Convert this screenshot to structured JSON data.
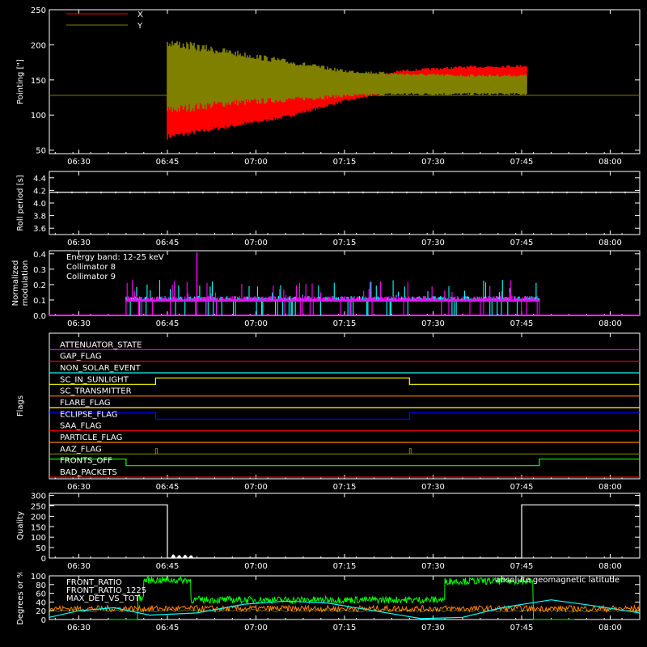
{
  "chart_data": [
    {
      "type": "line",
      "ylabel": "Pointing [\"]",
      "yticks": [
        50,
        100,
        150,
        200,
        250
      ],
      "ylim": [
        45,
        250
      ],
      "xticks": [
        "06:30",
        "06:45",
        "07:00",
        "07:15",
        "07:30",
        "07:45",
        "08:00"
      ],
      "xlim_min": [
        385,
        485
      ],
      "legend": [
        {
          "name": "X",
          "color": "#ff0000"
        },
        {
          "name": "Y",
          "color": "#808000"
        }
      ],
      "baseline": 128,
      "series": [
        {
          "name": "X",
          "color": "#ff0000",
          "x_min": [
            405,
            415,
            425,
            435,
            445,
            455,
            466
          ],
          "lo": [
            65,
            80,
            95,
            118,
            135,
            140,
            140
          ],
          "hi": [
            128,
            128,
            132,
            150,
            165,
            170,
            172
          ]
        },
        {
          "name": "Y",
          "color": "#808000",
          "x_min": [
            405,
            415,
            425,
            435,
            445,
            455,
            466
          ],
          "lo": [
            100,
            112,
            118,
            125,
            128,
            128,
            128
          ],
          "hi": [
            210,
            195,
            180,
            165,
            160,
            158,
            158
          ]
        }
      ]
    },
    {
      "type": "line",
      "ylabel": "Roll period [s]",
      "yticks": [
        "3.6",
        "3.8",
        "4.0",
        "4.2",
        "4.4"
      ],
      "ylim": [
        3.5,
        4.5
      ],
      "xticks": [
        "06:30",
        "06:45",
        "07:00",
        "07:15",
        "07:30",
        "07:45",
        "08:00"
      ],
      "xlim_min": [
        385,
        485
      ],
      "series": [
        {
          "name": "Roll period",
          "color": "#ffffff",
          "value": 4.17
        }
      ]
    },
    {
      "type": "line",
      "ylabel_lines": [
        "Normalized",
        "modulation"
      ],
      "yticks": [
        "0.0",
        "0.1",
        "0.2",
        "0.3",
        "0.4"
      ],
      "ylim": [
        0,
        0.42
      ],
      "xticks": [
        "06:30",
        "06:45",
        "07:00",
        "07:15",
        "07:30",
        "07:45",
        "08:00"
      ],
      "xlim_min": [
        385,
        485
      ],
      "annotation": "Energy band: 12-25 keV",
      "legend": [
        {
          "name": "Collimator 8",
          "color": "#00ffff"
        },
        {
          "name": "Collimator 9",
          "color": "#ff00ff"
        }
      ],
      "active_range_min": [
        398,
        468
      ],
      "typical_value": 0.1
    },
    {
      "type": "line",
      "ylabel": "Flags",
      "xticks": [
        "06:30",
        "06:45",
        "07:00",
        "07:15",
        "07:30",
        "07:45",
        "08:00"
      ],
      "xlim_min": [
        385,
        485
      ],
      "flags": [
        {
          "name": "ATTENUATOR_STATE",
          "color": "#ff00ff",
          "segments": [
            [
              385,
              485,
              0
            ]
          ]
        },
        {
          "name": "GAP_FLAG",
          "color": "#ff0000",
          "segments": [
            [
              385,
              485,
              0
            ]
          ]
        },
        {
          "name": "NON_SOLAR_EVENT",
          "color": "#00ffff",
          "segments": [
            [
              385,
              485,
              0
            ]
          ]
        },
        {
          "name": "SC_IN_SUNLIGHT",
          "color": "#ffff00",
          "segments": [
            [
              385,
              403,
              0
            ],
            [
              403,
              446,
              1
            ],
            [
              446,
              485,
              0
            ]
          ]
        },
        {
          "name": "SC_TRANSMITTER",
          "color": "#ff8000",
          "segments": [
            [
              385,
              485,
              0
            ]
          ]
        },
        {
          "name": "FLARE_FLAG",
          "color": "#ffff00",
          "segments": [
            [
              385,
              485,
              0
            ]
          ]
        },
        {
          "name": "ECLIPSE_FLAG",
          "color": "#0000ff",
          "segments": [
            [
              385,
              403,
              1
            ],
            [
              403,
              446,
              0
            ],
            [
              446,
              485,
              1
            ]
          ]
        },
        {
          "name": "SAA_FLAG",
          "color": "#ff0000",
          "segments": [
            [
              385,
              485,
              0
            ]
          ]
        },
        {
          "name": "PARTICLE_FLAG",
          "color": "#ff8000",
          "segments": [
            [
              385,
              485,
              0
            ]
          ]
        },
        {
          "name": "AAZ_FLAG",
          "color": "#808000",
          "segments": [
            [
              385,
              485,
              0
            ]
          ],
          "spikes": [
            403,
            446
          ]
        },
        {
          "name": "FRONTS_OFF",
          "color": "#00ff00",
          "segments": [
            [
              385,
              398,
              1
            ],
            [
              398,
              468,
              0
            ],
            [
              468,
              485,
              1
            ]
          ]
        },
        {
          "name": "BAD_PACKETS",
          "color": "#ff0000",
          "segments": [
            [
              385,
              485,
              0
            ]
          ]
        }
      ]
    },
    {
      "type": "line",
      "ylabel": "Quality",
      "yticks": [
        0,
        50,
        100,
        150,
        200,
        250,
        300
      ],
      "ylim": [
        0,
        310
      ],
      "xticks": [
        "06:30",
        "06:45",
        "07:00",
        "07:15",
        "07:30",
        "07:45",
        "08:00"
      ],
      "xlim_min": [
        385,
        485
      ],
      "segments": [
        [
          385,
          405,
          255
        ],
        [
          405,
          465,
          0
        ],
        [
          465,
          485,
          255
        ]
      ],
      "bumps": [
        [
          406.0,
          12
        ],
        [
          407.0,
          5
        ],
        [
          408.0,
          8
        ],
        [
          409.0,
          4
        ]
      ]
    },
    {
      "type": "line",
      "ylabel": "Degrees or %",
      "yticks": [
        0,
        20,
        40,
        60,
        80,
        100
      ],
      "ylim": [
        0,
        100
      ],
      "xticks": [
        "06:30",
        "06:45",
        "07:00",
        "07:15",
        "07:30",
        "07:45",
        "08:00"
      ],
      "xlim_min": [
        385,
        485
      ],
      "legend": [
        {
          "name": "FRONT_RATIO",
          "color": "#ffff00"
        },
        {
          "name": "FRONT_RATIO_1225",
          "color": "#00ff00"
        },
        {
          "name": "MAX_DET_VS_TOT",
          "color": "#ff8000"
        }
      ],
      "legend_right": {
        "name": "absolute geomagnetic latitude",
        "color": "#00ffff"
      },
      "series": [
        {
          "name": "FRONT_RATIO_1225",
          "color": "#00ff00",
          "segments": [
            [
              395,
              400,
              0
            ],
            [
              400,
              401,
              50
            ],
            [
              401,
              409,
              90
            ],
            [
              409,
              452,
              45
            ],
            [
              452,
              467,
              88
            ],
            [
              467,
              474,
              0
            ]
          ]
        },
        {
          "name": "MAX_DET_VS_TOT",
          "color": "#ff8000",
          "level": 25
        },
        {
          "name": "FRONT_RATIO",
          "color": "#ffff00",
          "level": 20
        },
        {
          "name": "absolute geomagnetic latitude",
          "color": "#00ffff",
          "x_min": [
            385,
            390,
            396,
            402,
            410,
            418,
            425,
            432,
            440,
            448,
            455,
            462,
            470,
            478,
            485
          ],
          "y": [
            5,
            20,
            27,
            10,
            15,
            35,
            42,
            38,
            20,
            2,
            5,
            28,
            45,
            30,
            15
          ]
        }
      ]
    }
  ]
}
